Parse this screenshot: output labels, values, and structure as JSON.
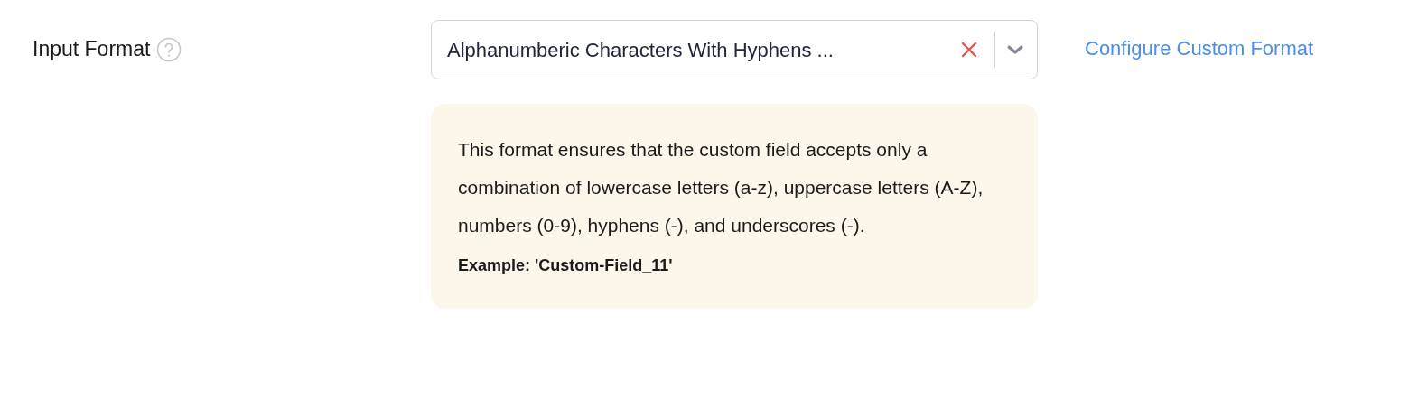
{
  "field": {
    "label": "Input Format",
    "select": {
      "value": "Alphanumberic Characters With Hyphens ..."
    },
    "link": "Configure Custom Format"
  },
  "info": {
    "description": "This format ensures that the custom field accepts only a combination of lowercase letters (a-z), uppercase letters (A-Z), numbers (0-9), hyphens (-), and underscores (-).",
    "example": "Example: 'Custom-Field_11'"
  }
}
